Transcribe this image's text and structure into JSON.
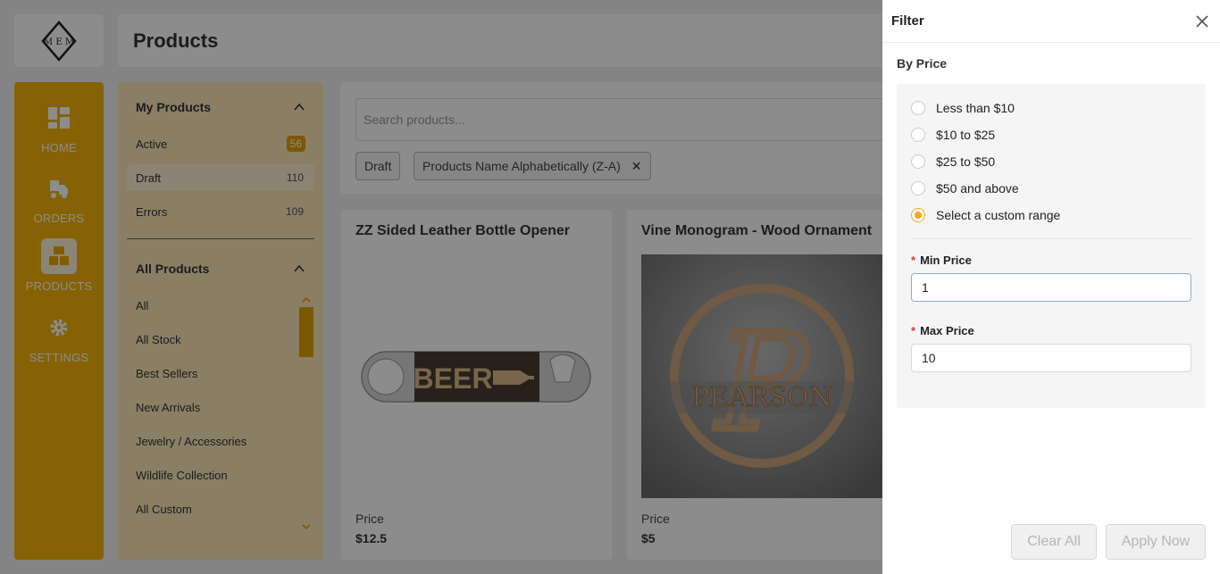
{
  "header": {
    "title": "Products"
  },
  "nav": {
    "items": [
      {
        "label": "HOME",
        "icon": "dashboard-icon"
      },
      {
        "label": "ORDERS",
        "icon": "truck-icon"
      },
      {
        "label": "PRODUCTS",
        "icon": "box-icon",
        "active": true
      },
      {
        "label": "SETTINGS",
        "icon": "gear-icon"
      }
    ]
  },
  "subnav": {
    "my_products": {
      "title": "My Products",
      "items": [
        {
          "label": "Active",
          "count": "56"
        },
        {
          "label": "Draft",
          "count": "110"
        },
        {
          "label": "Errors",
          "count": "109"
        }
      ]
    },
    "all_products": {
      "title": "All Products",
      "items": [
        "All",
        "All Stock",
        "Best Sellers",
        "New Arrivals",
        "Jewelry / Accessories",
        "Wildlife Collection",
        "All Custom"
      ]
    }
  },
  "search": {
    "placeholder": "Search products..."
  },
  "chips": [
    "Draft",
    "Products Name Alphabetically (Z-A)"
  ],
  "products": [
    {
      "title": "ZZ Sided Leather Bottle Opener",
      "price_label": "Price",
      "price": "$12.5",
      "image_text": "BEER"
    },
    {
      "title": "Vine Monogram - Wood Ornament",
      "price_label": "Price",
      "price": "$5",
      "image_text": "PEARSON",
      "image_letter": "P"
    }
  ],
  "filter": {
    "title": "Filter",
    "section": "By Price",
    "options": [
      {
        "label": "Less than $10",
        "checked": false
      },
      {
        "label": "$10 to $25",
        "checked": false
      },
      {
        "label": "$25 to $50",
        "checked": false
      },
      {
        "label": "$50 and above",
        "checked": false
      },
      {
        "label": "Select a custom range",
        "checked": true
      }
    ],
    "min_label": "Min Price",
    "min_value": "1",
    "max_label": "Max Price",
    "max_value": "10",
    "required_mark": "*",
    "clear_label": "Clear All",
    "apply_label": "Apply Now"
  },
  "colors": {
    "accent": "#f5b20a",
    "radio_checked": "#f5a623"
  }
}
